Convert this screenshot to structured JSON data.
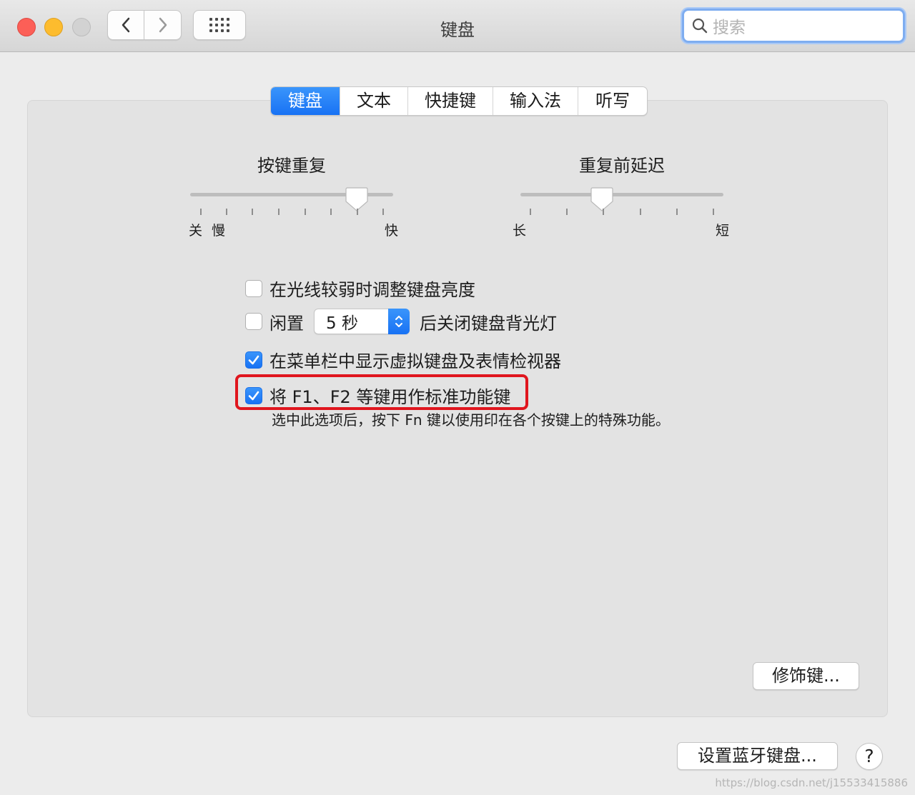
{
  "window": {
    "title": "键盘"
  },
  "search": {
    "placeholder": "搜索"
  },
  "tabs": [
    {
      "label": "键盘",
      "active": true
    },
    {
      "label": "文本",
      "active": false
    },
    {
      "label": "快捷键",
      "active": false
    },
    {
      "label": "输入法",
      "active": false
    },
    {
      "label": "听写",
      "active": false
    }
  ],
  "key_repeat": {
    "title": "按键重复",
    "label_off": "关",
    "label_slow": "慢",
    "label_fast": "快",
    "value_fraction": 0.82
  },
  "delay_until_repeat": {
    "title": "重复前延迟",
    "label_long": "长",
    "label_short": "短",
    "value_fraction": 0.4
  },
  "options": {
    "adjust_brightness": {
      "label": "在光线较弱时调整键盘亮度",
      "checked": false
    },
    "backlight_off": {
      "label_before": "闲置",
      "popup_value": "5 秒",
      "label_after": "后关闭键盘背光灯",
      "checked": false
    },
    "show_viewer": {
      "label": "在菜单栏中显示虚拟键盘及表情检视器",
      "checked": true
    },
    "fn_keys": {
      "label": "将 F1、F2 等键用作标准功能键",
      "checked": true,
      "description": "选中此选项后，按下 Fn 键以使用印在各个按键上的特殊功能。"
    }
  },
  "buttons": {
    "modifier_keys": "修饰键...",
    "bluetooth_keyboard": "设置蓝牙键盘...",
    "help": "?"
  },
  "watermark": "https://blog.csdn.net/j15533415886",
  "colors": {
    "accent": "#1872f4",
    "highlight_border": "#e0161e"
  }
}
